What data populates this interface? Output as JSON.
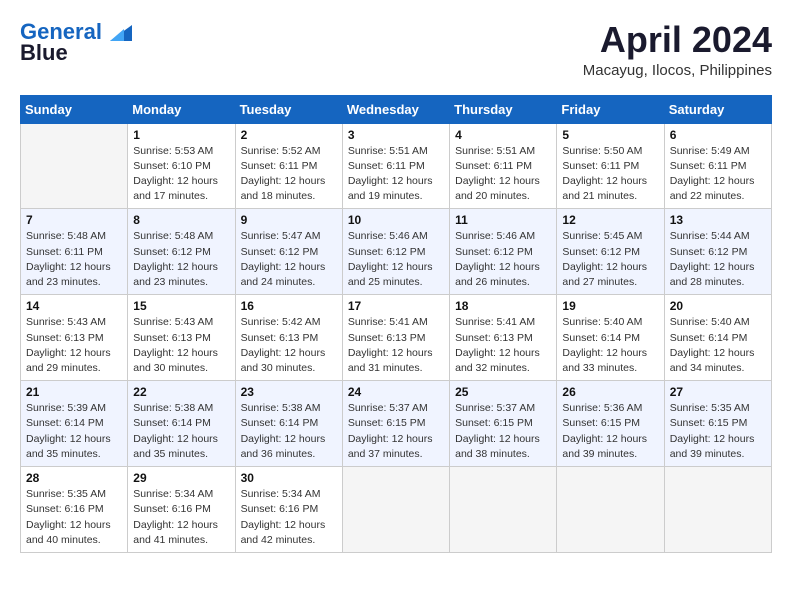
{
  "header": {
    "logo_line1": "General",
    "logo_line2": "Blue",
    "month_title": "April 2024",
    "location": "Macayug, Ilocos, Philippines"
  },
  "weekdays": [
    "Sunday",
    "Monday",
    "Tuesday",
    "Wednesday",
    "Thursday",
    "Friday",
    "Saturday"
  ],
  "weeks": [
    [
      {
        "day": "",
        "info": ""
      },
      {
        "day": "1",
        "info": "Sunrise: 5:53 AM\nSunset: 6:10 PM\nDaylight: 12 hours\nand 17 minutes."
      },
      {
        "day": "2",
        "info": "Sunrise: 5:52 AM\nSunset: 6:11 PM\nDaylight: 12 hours\nand 18 minutes."
      },
      {
        "day": "3",
        "info": "Sunrise: 5:51 AM\nSunset: 6:11 PM\nDaylight: 12 hours\nand 19 minutes."
      },
      {
        "day": "4",
        "info": "Sunrise: 5:51 AM\nSunset: 6:11 PM\nDaylight: 12 hours\nand 20 minutes."
      },
      {
        "day": "5",
        "info": "Sunrise: 5:50 AM\nSunset: 6:11 PM\nDaylight: 12 hours\nand 21 minutes."
      },
      {
        "day": "6",
        "info": "Sunrise: 5:49 AM\nSunset: 6:11 PM\nDaylight: 12 hours\nand 22 minutes."
      }
    ],
    [
      {
        "day": "7",
        "info": "Sunrise: 5:48 AM\nSunset: 6:11 PM\nDaylight: 12 hours\nand 23 minutes."
      },
      {
        "day": "8",
        "info": "Sunrise: 5:48 AM\nSunset: 6:12 PM\nDaylight: 12 hours\nand 23 minutes."
      },
      {
        "day": "9",
        "info": "Sunrise: 5:47 AM\nSunset: 6:12 PM\nDaylight: 12 hours\nand 24 minutes."
      },
      {
        "day": "10",
        "info": "Sunrise: 5:46 AM\nSunset: 6:12 PM\nDaylight: 12 hours\nand 25 minutes."
      },
      {
        "day": "11",
        "info": "Sunrise: 5:46 AM\nSunset: 6:12 PM\nDaylight: 12 hours\nand 26 minutes."
      },
      {
        "day": "12",
        "info": "Sunrise: 5:45 AM\nSunset: 6:12 PM\nDaylight: 12 hours\nand 27 minutes."
      },
      {
        "day": "13",
        "info": "Sunrise: 5:44 AM\nSunset: 6:12 PM\nDaylight: 12 hours\nand 28 minutes."
      }
    ],
    [
      {
        "day": "14",
        "info": "Sunrise: 5:43 AM\nSunset: 6:13 PM\nDaylight: 12 hours\nand 29 minutes."
      },
      {
        "day": "15",
        "info": "Sunrise: 5:43 AM\nSunset: 6:13 PM\nDaylight: 12 hours\nand 30 minutes."
      },
      {
        "day": "16",
        "info": "Sunrise: 5:42 AM\nSunset: 6:13 PM\nDaylight: 12 hours\nand 30 minutes."
      },
      {
        "day": "17",
        "info": "Sunrise: 5:41 AM\nSunset: 6:13 PM\nDaylight: 12 hours\nand 31 minutes."
      },
      {
        "day": "18",
        "info": "Sunrise: 5:41 AM\nSunset: 6:13 PM\nDaylight: 12 hours\nand 32 minutes."
      },
      {
        "day": "19",
        "info": "Sunrise: 5:40 AM\nSunset: 6:14 PM\nDaylight: 12 hours\nand 33 minutes."
      },
      {
        "day": "20",
        "info": "Sunrise: 5:40 AM\nSunset: 6:14 PM\nDaylight: 12 hours\nand 34 minutes."
      }
    ],
    [
      {
        "day": "21",
        "info": "Sunrise: 5:39 AM\nSunset: 6:14 PM\nDaylight: 12 hours\nand 35 minutes."
      },
      {
        "day": "22",
        "info": "Sunrise: 5:38 AM\nSunset: 6:14 PM\nDaylight: 12 hours\nand 35 minutes."
      },
      {
        "day": "23",
        "info": "Sunrise: 5:38 AM\nSunset: 6:14 PM\nDaylight: 12 hours\nand 36 minutes."
      },
      {
        "day": "24",
        "info": "Sunrise: 5:37 AM\nSunset: 6:15 PM\nDaylight: 12 hours\nand 37 minutes."
      },
      {
        "day": "25",
        "info": "Sunrise: 5:37 AM\nSunset: 6:15 PM\nDaylight: 12 hours\nand 38 minutes."
      },
      {
        "day": "26",
        "info": "Sunrise: 5:36 AM\nSunset: 6:15 PM\nDaylight: 12 hours\nand 39 minutes."
      },
      {
        "day": "27",
        "info": "Sunrise: 5:35 AM\nSunset: 6:15 PM\nDaylight: 12 hours\nand 39 minutes."
      }
    ],
    [
      {
        "day": "28",
        "info": "Sunrise: 5:35 AM\nSunset: 6:16 PM\nDaylight: 12 hours\nand 40 minutes."
      },
      {
        "day": "29",
        "info": "Sunrise: 5:34 AM\nSunset: 6:16 PM\nDaylight: 12 hours\nand 41 minutes."
      },
      {
        "day": "30",
        "info": "Sunrise: 5:34 AM\nSunset: 6:16 PM\nDaylight: 12 hours\nand 42 minutes."
      },
      {
        "day": "",
        "info": ""
      },
      {
        "day": "",
        "info": ""
      },
      {
        "day": "",
        "info": ""
      },
      {
        "day": "",
        "info": ""
      }
    ]
  ]
}
